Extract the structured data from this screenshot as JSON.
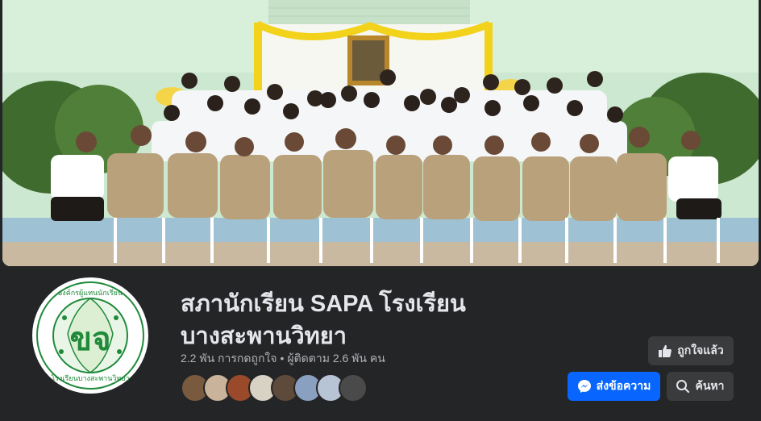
{
  "page": {
    "name": "สภานักเรียน SAPA โรงเรียนบางสะพานวิทยา",
    "likes": "2.2 พัน การกดถูกใจ",
    "separator": "•",
    "followers": "ผู้ติดตาม 2.6 พัน คน"
  },
  "logo": {
    "top_text": "องค์กรผู้แทนนักเรียน",
    "bottom_text": "โรงเรียนบางสะพานวิทยา",
    "monogram": "ขจ"
  },
  "buttons": {
    "like_label": "ถูกใจแล้ว",
    "message_label": "ส่งข้อความ",
    "search_label": "ค้นหา"
  },
  "icons": {
    "like": "thumbs-up-icon",
    "message": "messenger-icon",
    "search": "search-icon"
  },
  "colors": {
    "background": "#242526",
    "primary_button": "#0866ff",
    "secondary_button": "#3a3b3c",
    "text_primary": "#e4e6eb",
    "text_secondary": "#b0b3b8",
    "logo_green": "#1f8a3a"
  }
}
